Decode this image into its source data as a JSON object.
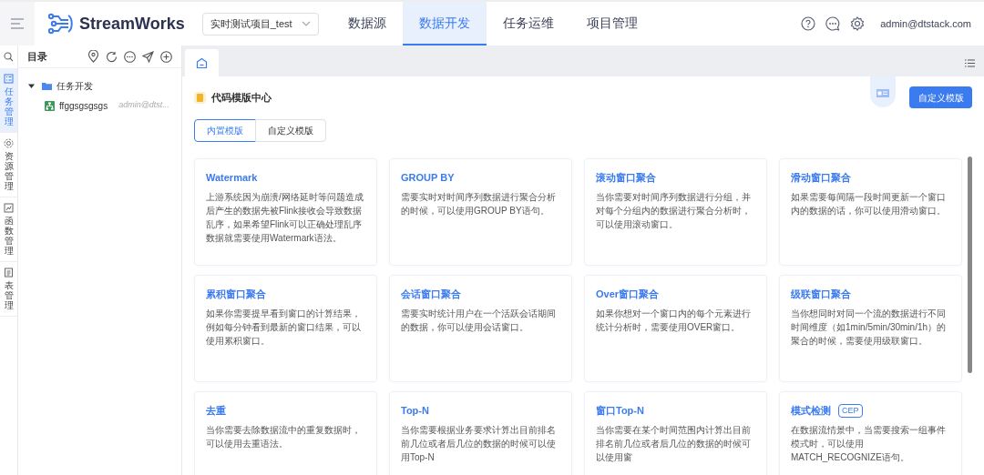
{
  "header": {
    "app_name": "StreamWorks",
    "project_select": {
      "value": "实时测试项目_test"
    },
    "nav": [
      {
        "label": "数据源",
        "selected": false
      },
      {
        "label": "数据开发",
        "selected": true
      },
      {
        "label": "任务运维",
        "selected": false
      },
      {
        "label": "项目管理",
        "selected": false
      }
    ],
    "user": "admin@dtstack.com"
  },
  "rail": [
    {
      "label": "任务管理",
      "selected": true
    },
    {
      "label": "资源管理",
      "selected": false
    },
    {
      "label": "函数管理",
      "selected": false
    },
    {
      "label": "表管理",
      "selected": false
    }
  ],
  "sidebar": {
    "title": "目录",
    "tree": [
      {
        "label": "任务开发",
        "expanded": true,
        "children": [
          {
            "label": "ffggsgsgsgs",
            "owner": "admin@dtst..."
          }
        ]
      }
    ]
  },
  "page": {
    "title": "代码模版中心",
    "create_button": "自定义模版",
    "tabs": [
      {
        "label": "内置模版",
        "selected": true
      },
      {
        "label": "自定义模版",
        "selected": false
      }
    ],
    "templates": [
      {
        "title": "Watermark",
        "description": "上游系统因为崩溃/网络延时等问题造成后产生的数据先被Flink接收会导致数据乱序，如果希望Flink可以正确处理乱序数据就需要使用Watermark语法。"
      },
      {
        "title": "GROUP BY",
        "description": "需要实时对时间序列数据进行聚合分析的时候，可以使用GROUP BY语句。"
      },
      {
        "title": "滚动窗口聚合",
        "description": "当你需要对时间序列数据进行分组，并对每个分组内的数据进行聚合分析时，可以使用滚动窗口。"
      },
      {
        "title": "滑动窗口聚合",
        "description": "如果需要每间隔一段时间更新一个窗口内的数据的话，你可以使用滑动窗口。"
      },
      {
        "title": "累积窗口聚合",
        "description": "如果你需要提早看到窗口的计算结果，例如每分钟看到最新的窗口结果，可以使用累积窗口。"
      },
      {
        "title": "会话窗口聚合",
        "description": "需要实时统计用户在一个活跃会话期间的数据，你可以使用会话窗口。"
      },
      {
        "title": "Over窗口聚合",
        "description": "如果你想对一个窗口内的每个元素进行统计分析时，需要使用OVER窗口。"
      },
      {
        "title": "级联窗口聚合",
        "description": "当你想同时对同一个流的数据进行不同时间维度（如1min/5min/30min/1h）的聚合的时候，需要使用级联窗口。"
      },
      {
        "title": "去重",
        "description": "当你需要去除数据流中的重复数据时，可以使用去重语法。"
      },
      {
        "title": "Top-N",
        "description": "当你需要根据业务要求计算出目前排名前几位或者后几位的数据的时候可以使用Top-N"
      },
      {
        "title": "窗口Top-N",
        "description": "当你需要在某个时间范围内计算出目前排名前几位或者后几位的数据的时候可以使用窗"
      },
      {
        "title": "模式检测",
        "tag": "CEP",
        "description": "在数据流情景中，当需要搜索一组事件模式时，可以使用MATCH_RECOGNIZE语句。"
      }
    ]
  }
}
